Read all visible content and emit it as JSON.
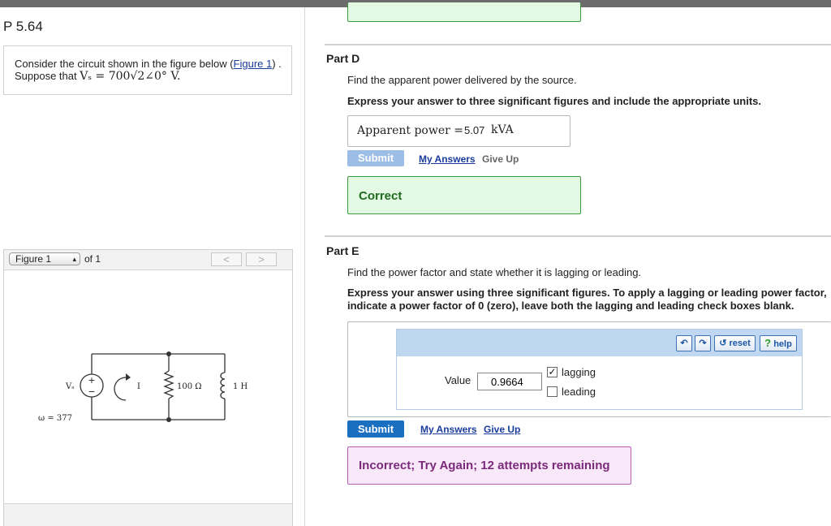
{
  "problem": {
    "title": "P 5.64",
    "intro_prefix": "Consider the circuit shown in the figure below (",
    "figure_link": "Figure 1",
    "intro_suffix": ") .",
    "suppose_prefix": "Suppose that ",
    "suppose_math": "Vₛ = 700√2∠0° V."
  },
  "figure": {
    "select_value": "Figure 1",
    "of_label": "of 1",
    "prev": "<",
    "next": ">",
    "labels": {
      "vs": "Vₛ",
      "omega": "ω = 377",
      "current": "I",
      "resistor": "100 Ω",
      "inductor": "1 H",
      "plus": "+",
      "minus": "−"
    }
  },
  "partD": {
    "label": "Part D",
    "question": "Find the apparent power delivered by the source.",
    "instruction": "Express your answer to three significant figures and include the appropriate units.",
    "answer_label": "Apparent power =",
    "answer_value": "5.07",
    "answer_unit": "kVA",
    "submit": "Submit",
    "my_answers": "My Answers",
    "give_up": "Give Up",
    "feedback": "Correct"
  },
  "partE": {
    "label": "Part E",
    "question": "Find the power factor and state whether it is lagging or leading.",
    "instruction_line1": "Express your answer using three significant figures. To apply a lagging or leading power factor,",
    "instruction_line2": "indicate a power factor of 0 (zero), leave both the lagging and leading check boxes blank.",
    "toolbar": {
      "reset": "reset",
      "help": "help"
    },
    "value_label": "Value",
    "value": "0.9664",
    "lagging": {
      "label": "lagging",
      "checked": true
    },
    "leading": {
      "label": "leading",
      "checked": false
    },
    "submit": "Submit",
    "my_answers": "My Answers",
    "give_up": "Give Up",
    "feedback": "Incorrect; Try Again; 12 attempts remaining"
  },
  "colors": {
    "submit_active": "#1a6fc0",
    "submit_disabled": "#9bbde6",
    "correct_text": "#1f6b1f",
    "incorrect_text": "#7a2a7a"
  }
}
